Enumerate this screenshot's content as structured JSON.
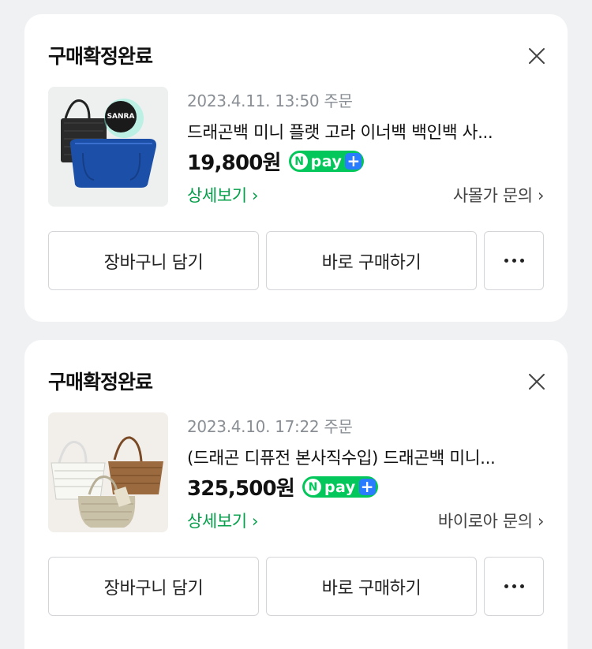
{
  "orders": [
    {
      "status": "구매확정완료",
      "date": "2023.4.11. 13:50 주문",
      "title": "드래곤백 미니 플랫 고라 이너백 백인백 사...",
      "price": "19,800원",
      "npay": {
        "n": "N",
        "pay": "pay",
        "plus": "+"
      },
      "detail_link": "상세보기 ›",
      "inquiry_link": "사몰가 문의 ›",
      "buttons": {
        "cart": "장바구니 담기",
        "buy": "바로 구매하기"
      },
      "thumb_logo": "SANRA"
    },
    {
      "status": "구매확정완료",
      "date": "2023.4.10. 17:22 주문",
      "title": "(드래곤 디퓨전 본사직수입) 드래곤백 미니...",
      "price": "325,500원",
      "npay": {
        "n": "N",
        "pay": "pay",
        "plus": "+"
      },
      "detail_link": "상세보기 ›",
      "inquiry_link": "바이로아 문의 ›",
      "buttons": {
        "cart": "장바구니 담기",
        "buy": "바로 구매하기"
      }
    }
  ],
  "colors": {
    "accent_green": "#03c75a",
    "link_green": "#049f4a",
    "npay_plus": "#2a7cff"
  },
  "icons": [
    "close-icon",
    "more-dots-icon",
    "chevron-right-icon"
  ]
}
